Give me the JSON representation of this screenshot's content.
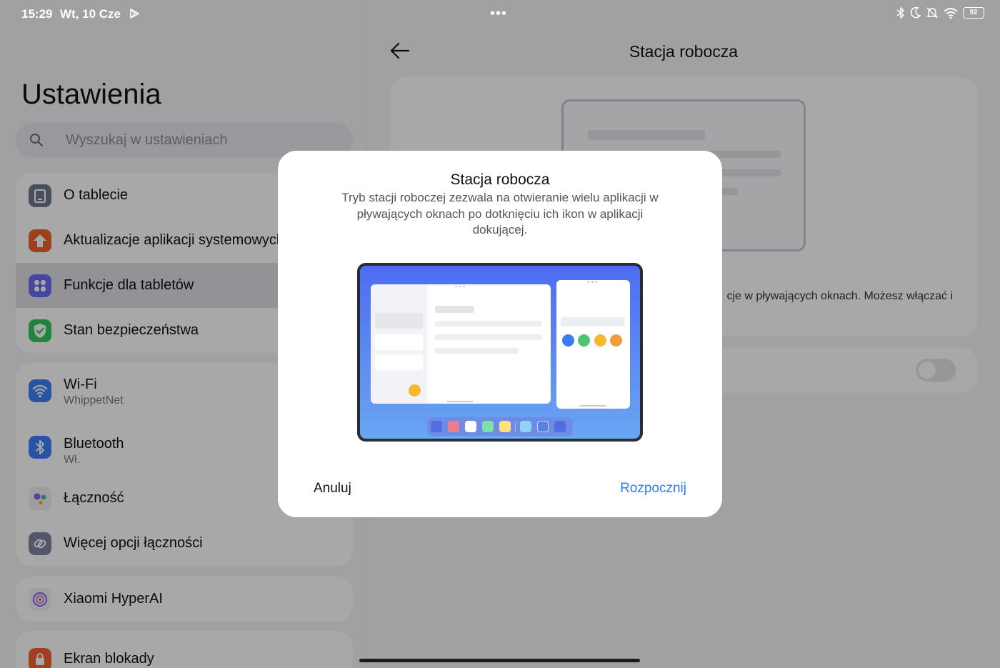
{
  "status_bar": {
    "time": "15:29",
    "date": "Wt, 10 Cze",
    "battery": "92",
    "icons": [
      "play-store-icon",
      "bluetooth-icon",
      "moon-icon",
      "bell-off-icon",
      "wifi-icon",
      "battery-icon"
    ]
  },
  "sidebar": {
    "title": "Ustawienia",
    "search_placeholder": "Wyszukaj w ustawieniach",
    "groups": [
      [
        {
          "label": "O tablecie",
          "icon": "tablet-icon",
          "color": "#6f7890"
        },
        {
          "label": "Aktualizacje aplikacji systemowych",
          "icon": "arrow-up-icon",
          "color": "#f0622d"
        },
        {
          "label": "Funkcje dla tabletów",
          "icon": "grid-icon",
          "color": "#6b6cf0",
          "selected": true
        },
        {
          "label": "Stan bezpieczeństwa",
          "icon": "shield-check-icon",
          "color": "#34c759"
        }
      ],
      [
        {
          "label": "Wi-Fi",
          "sub": "WhippetNet",
          "icon": "wifi-icon",
          "color": "#3d82f7"
        },
        {
          "label": "Bluetooth",
          "sub": "Wł.",
          "icon": "bluetooth-icon",
          "color": "#3d82f7"
        },
        {
          "label": "Łączność",
          "icon": "connectivity-icon",
          "color": "#9a74f0"
        },
        {
          "label": "Więcej opcji łączności",
          "icon": "link-icon",
          "color": "#7d84a0"
        }
      ],
      [
        {
          "label": "Xiaomi HyperAI",
          "icon": "hyperai-icon",
          "color": "#8e7bf2"
        }
      ],
      [
        {
          "label": "Ekran blokady",
          "icon": "lock-icon",
          "color": "#f0622d"
        }
      ]
    ]
  },
  "detail": {
    "title": "Stacja robocza",
    "description_fragment": "cje w pływających oknach. Możesz włączać i",
    "toggle_on": false
  },
  "dialog": {
    "title": "Stacja robocza",
    "body": "Tryb stacji roboczej zezwala na otwieranie wielu aplikacji w pływających oknach po dotknięciu ich ikon w aplikacji dokującej.",
    "cancel_label": "Anuluj",
    "start_label": "Rozpocznij",
    "accent_color": "#2f7cf6"
  }
}
